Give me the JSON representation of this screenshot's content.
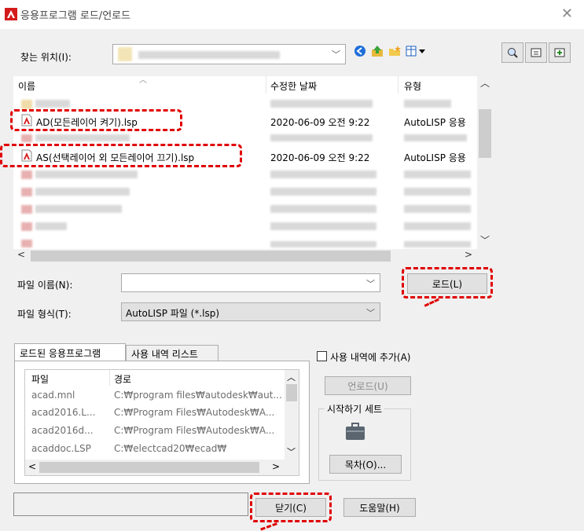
{
  "window": {
    "title": "응용프로그램 로드/언로드",
    "close_glyph": "✕"
  },
  "lookin": {
    "label": "찾는 위치(I):",
    "value": ""
  },
  "filelist": {
    "columns": [
      "이름",
      "수정한 날짜",
      "유형"
    ],
    "rows": [
      {
        "name": "AD(모든레이어 켜기).lsp",
        "date": "2020-06-09 오전 9:22",
        "type": "AutoLISP 응용"
      },
      {
        "name": "AS(선택레이어 외 모든레이어 끄기).lsp",
        "date": "2020-06-09 오전 9:22",
        "type": "AutoLISP 응용"
      }
    ]
  },
  "filename": {
    "label": "파일 이름(N):",
    "value": ""
  },
  "filetype": {
    "label": "파일 형식(T):",
    "value": "AutoLISP 파일 (*.lsp)"
  },
  "load_button": "로드(L)",
  "tabs": [
    "로드된 응용프로그램",
    "사용 내역 리스트"
  ],
  "loaded": {
    "columns": [
      "파일",
      "경로"
    ],
    "rows": [
      {
        "file": "acad.mnl",
        "path": "C:₩program files₩autodesk₩aut..."
      },
      {
        "file": "acad2016.L...",
        "path": "C:₩Program Files₩Autodesk₩A..."
      },
      {
        "file": "acad2016d...",
        "path": "C:₩Program Files₩Autodesk₩A..."
      },
      {
        "file": "acaddoc.LSP",
        "path": "C:₩electcad20₩ecad₩"
      }
    ]
  },
  "history_checkbox": "사용 내역에 추가(A)",
  "unload_button": "언로드(U)",
  "startup": {
    "label": "시작하기 세트",
    "contents_button": "목차(O)..."
  },
  "close_button": "닫기(C)",
  "help_button": "도움말(H)",
  "colors": {
    "accent_red": "#e00000",
    "autocad_red": "#d41b1b"
  }
}
